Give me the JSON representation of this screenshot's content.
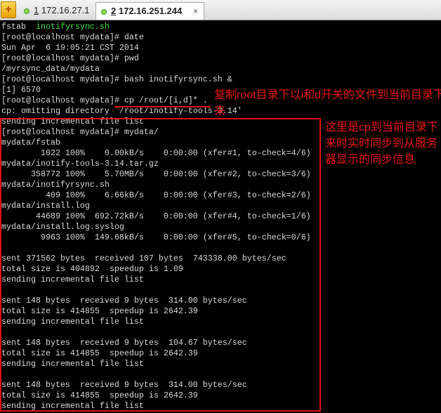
{
  "tabs": [
    {
      "num": "1",
      "label": "172.16.27.1"
    },
    {
      "num": "2",
      "label": "172.16.251.244",
      "close": "×"
    }
  ],
  "terminal": {
    "first_line": {
      "a": "fstab  ",
      "b": "inotifyrsync.sh"
    },
    "lines": [
      "[root@localhost mydata]# date",
      "Sun Apr  6 19:05:21 CST 2014",
      "[root@localhost mydata]# pwd",
      "/myrsync_data/mydata",
      "[root@localhost mydata]# bash inotifyrsync.sh &",
      "[1] 6570",
      "[root@localhost mydata]# cp /root/[i,d]* .",
      "cp: omitting directory `/root/inotify-tools-3.14'",
      "sending incremental file list",
      "[root@localhost mydata]# mydata/",
      "mydata/fstab",
      "        1022 100%    0.00kB/s    0:00:00 (xfer#1, to-check=4/6)",
      "mydata/inotify-tools-3.14.tar.gz",
      "      358772 100%    5.70MB/s    0:00:00 (xfer#2, to-check=3/6)",
      "mydata/inotifyrsync.sh",
      "         409 100%    6.66kB/s    0:00:00 (xfer#3, to-check=2/6)",
      "mydata/install.log",
      "       44689 100%  692.72kB/s    0:00:00 (xfer#4, to-check=1/6)",
      "mydata/install.log.syslog",
      "        9963 100%  149.68kB/s    0:00:00 (xfer#5, to-check=0/6)",
      "",
      "sent 371562 bytes  received 107 bytes  743338.00 bytes/sec",
      "total size is 404892  speedup is 1.09",
      "sending incremental file list",
      "",
      "sent 148 bytes  received 9 bytes  314.00 bytes/sec",
      "total size is 414855  speedup is 2642.39",
      "sending incremental file list",
      "",
      "sent 148 bytes  received 9 bytes  104.67 bytes/sec",
      "total size is 414855  speedup is 2642.39",
      "sending incremental file list",
      "",
      "sent 148 bytes  received 9 bytes  314.00 bytes/sec",
      "total size is 414855  speedup is 2642.39",
      "sending incremental file list"
    ]
  },
  "annotations": {
    "cp_note": "复制root目录下以i和d开关的文件到当前目录下来",
    "sync_note": "这里是cp到当前目录下来时实时同步到从服务器显示的同步信息"
  }
}
